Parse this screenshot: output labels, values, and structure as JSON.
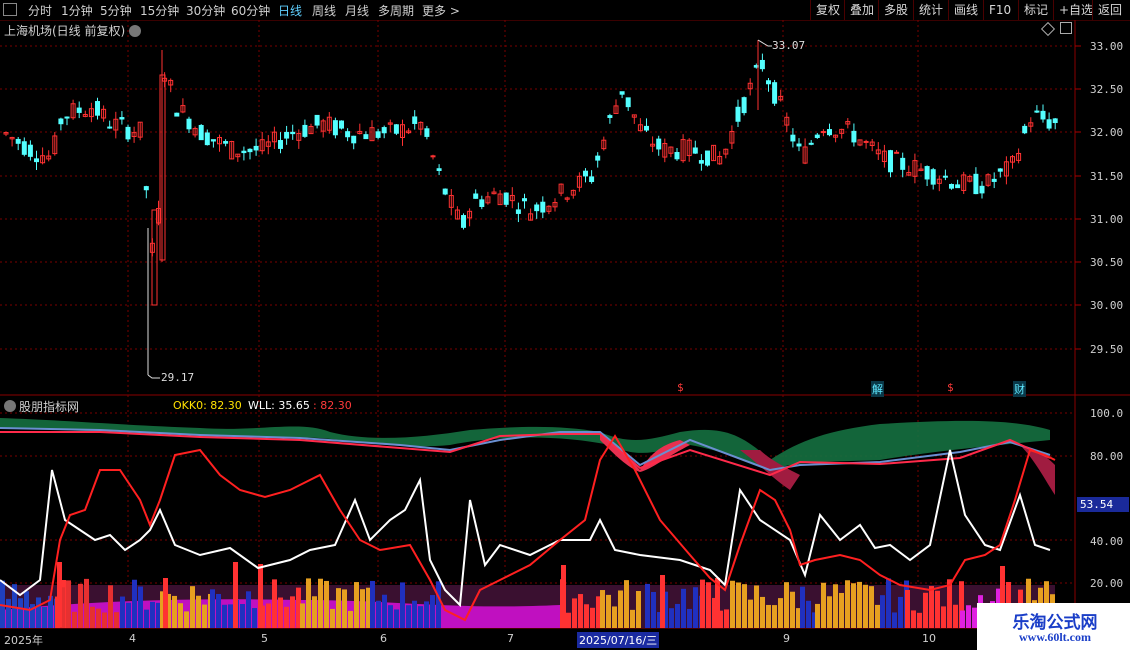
{
  "toolbar": {
    "tabs": [
      "分时",
      "1分钟",
      "5分钟",
      "15分钟",
      "30分钟",
      "60分钟",
      "日线",
      "周线",
      "月线",
      "多周期",
      "更多 >"
    ],
    "active_tab": "日线",
    "right_buttons": [
      "复权",
      "叠加",
      "多股",
      "统计",
      "画线",
      "F10",
      "标记",
      "+自选",
      "返回"
    ]
  },
  "main_panel": {
    "title": "上海机场(日线 前复权)",
    "y_ticks": [
      "33.00",
      "32.50",
      "32.00",
      "31.50",
      "31.00",
      "30.50",
      "30.00",
      "29.50"
    ],
    "high_label": "33.07",
    "low_label": "29.17",
    "event_marks": [
      "$",
      "解",
      "$",
      "财"
    ]
  },
  "indicator_panel": {
    "name": "股朋指标网",
    "okk0_label": "OKK0: 82.30",
    "wll_label": "WLL: 35.65",
    "third_label": ": 82.30",
    "y_ticks": [
      "100.0",
      "80.00",
      "53.54",
      "40.00",
      "20.00"
    ],
    "current_value": "53.54"
  },
  "x_axis": {
    "labels": [
      "2025年",
      "4",
      "5",
      "6",
      "7",
      "2025/07/16/三",
      "9",
      "10"
    ]
  },
  "watermark": {
    "line1": "乐淘公式网",
    "line2": "www.60lt.com"
  },
  "colors": {
    "up": "#ff3232",
    "down": "#54ffff",
    "grid": "#7a0000",
    "white_line": "#ffffff",
    "red_line": "#ff2020",
    "orange_bar": "#e6a020",
    "blue_bar": "#2030c0",
    "magenta_bar": "#e020e0"
  }
}
